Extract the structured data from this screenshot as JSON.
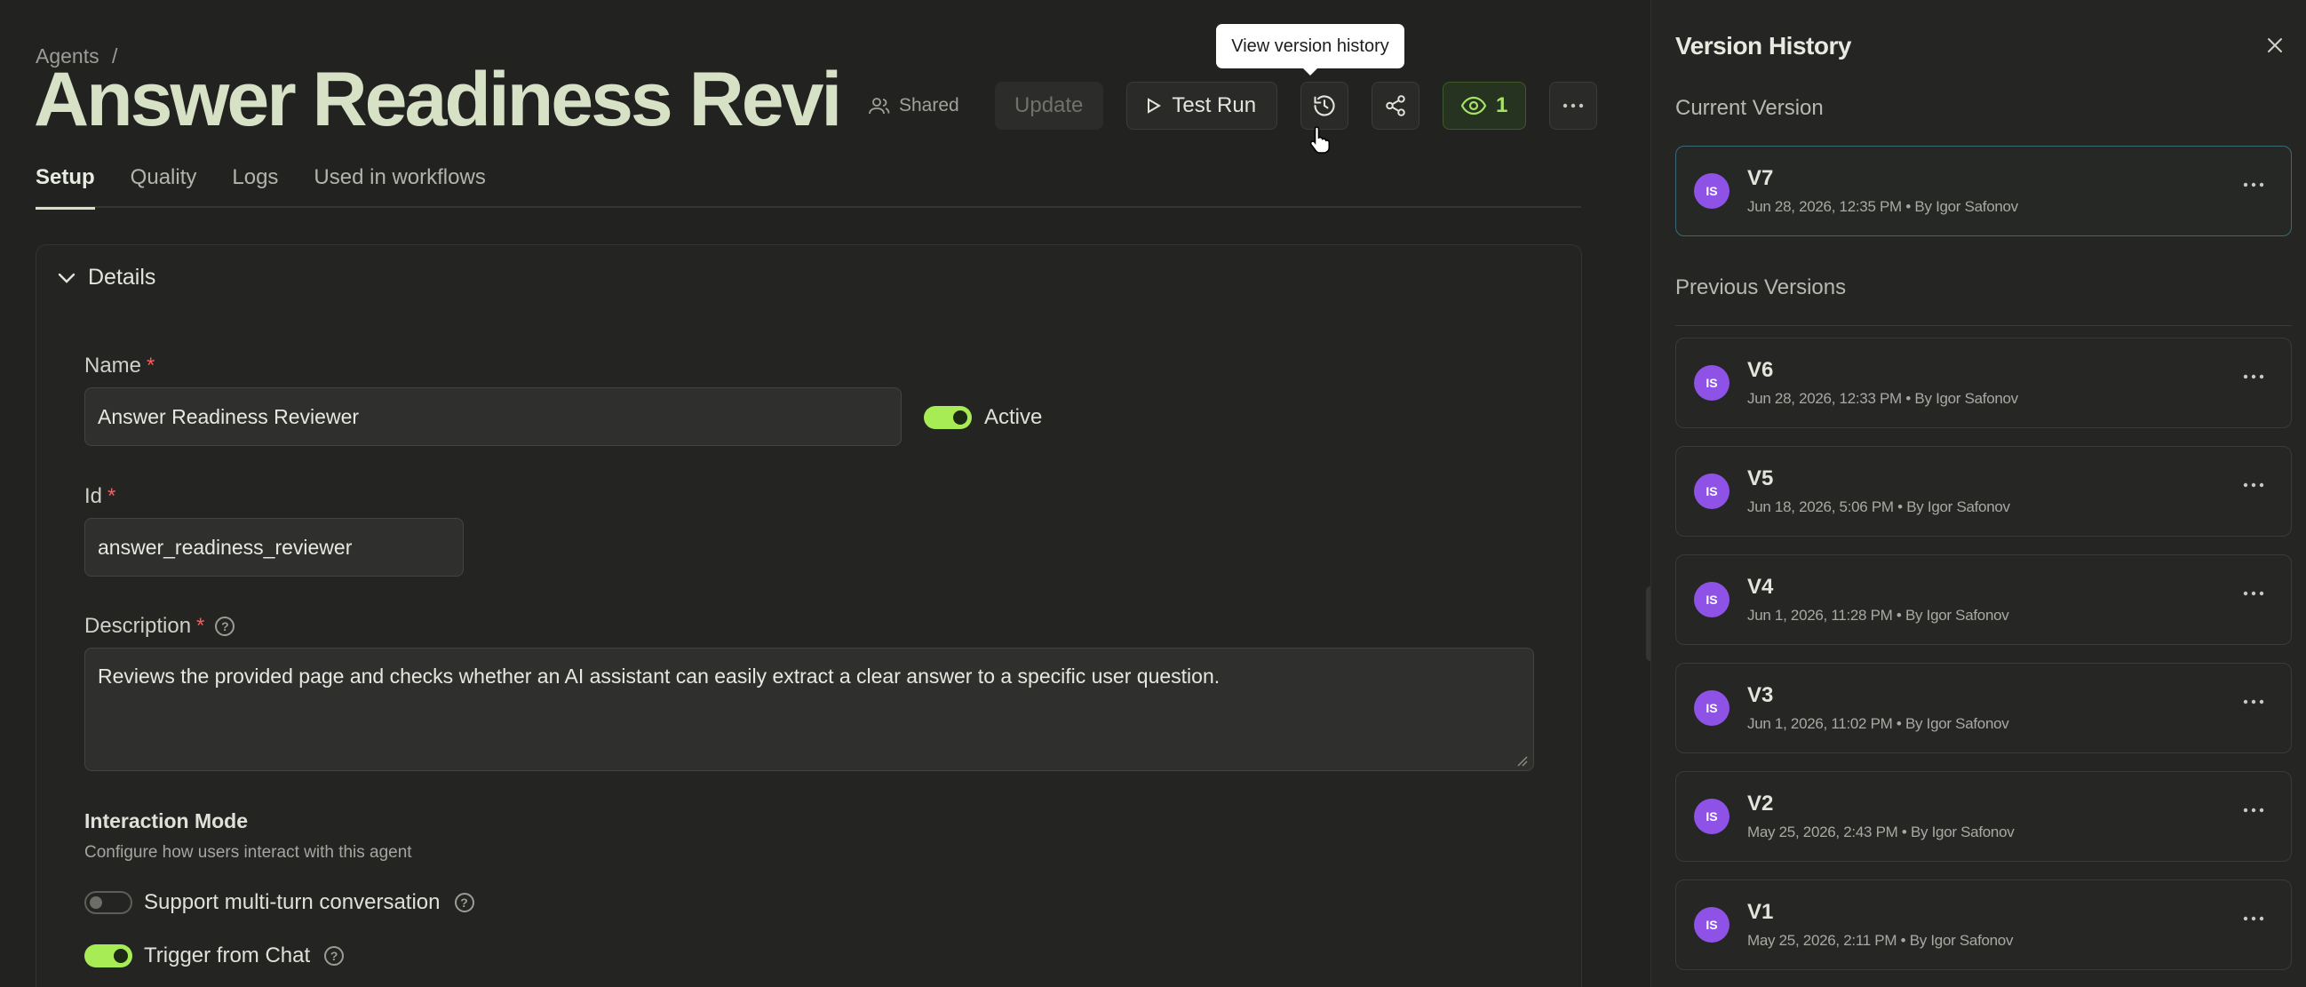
{
  "breadcrumb": {
    "parent": "Agents",
    "separator": "/"
  },
  "header": {
    "title": "Answer Readiness Revi...",
    "shared_label": "Shared",
    "update_label": "Update",
    "test_run_label": "Test Run",
    "viewers_count": "1",
    "tooltip": "View version history"
  },
  "tabs": [
    "Setup",
    "Quality",
    "Logs",
    "Used in workflows"
  ],
  "details": {
    "heading": "Details",
    "name_label": "Name",
    "name_value": "Answer Readiness Reviewer",
    "active_label": "Active",
    "id_label": "Id",
    "id_value": "answer_readiness_reviewer",
    "description_label": "Description",
    "description_value": "Reviews the provided page and checks whether an AI assistant can easily extract a clear answer to a specific user question.",
    "required_mark": "*",
    "help_glyph": "?"
  },
  "interaction": {
    "title": "Interaction Mode",
    "subtitle": "Configure how users interact with this agent",
    "multi_turn_label": "Support multi-turn conversation",
    "multi_turn_on": false,
    "trigger_chat_label": "Trigger from Chat",
    "trigger_chat_on": true
  },
  "version_history": {
    "title": "Version History",
    "current_heading": "Current Version",
    "previous_heading": "Previous Versions",
    "avatar_initials": "IS",
    "current": {
      "name": "V7",
      "meta": "Jun 28, 2026, 12:35 PM • By Igor Safonov"
    },
    "previous": [
      {
        "name": "V6",
        "meta": "Jun 28, 2026, 12:33 PM • By Igor Safonov"
      },
      {
        "name": "V5",
        "meta": "Jun 18, 2026, 5:06 PM • By Igor Safonov"
      },
      {
        "name": "V4",
        "meta": "Jun 1, 2026, 11:28 PM • By Igor Safonov"
      },
      {
        "name": "V3",
        "meta": "Jun 1, 2026, 11:02 PM • By Igor Safonov"
      },
      {
        "name": "V2",
        "meta": "May 25, 2026, 2:43 PM • By Igor Safonov"
      },
      {
        "name": "V1",
        "meta": "May 25, 2026, 2:11 PM • By Igor Safonov"
      }
    ]
  },
  "colors": {
    "accent": "#a7eb55",
    "title": "#d7e1c6",
    "avatar": "#8e52e6",
    "required": "#ff5a5a"
  }
}
